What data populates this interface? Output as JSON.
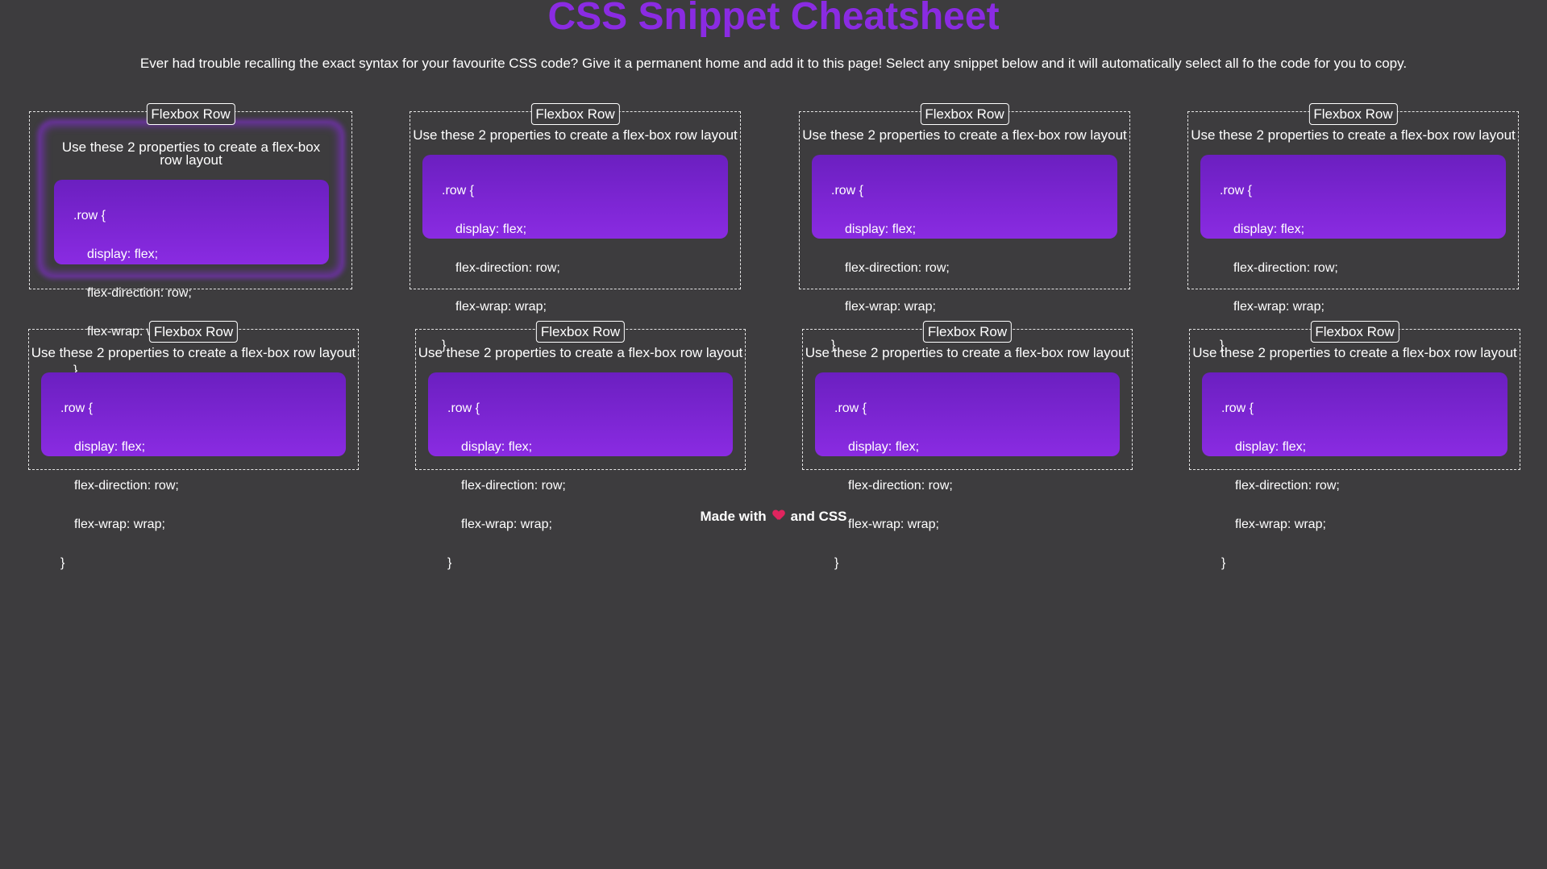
{
  "page": {
    "title": "CSS Snippet Cheatsheet",
    "intro": "Ever had trouble recalling the exact syntax for your favourite CSS code? Give it a permanent home and add it to this page! Select any snippet below and it will automatically select all fo the code for you to copy."
  },
  "snippets": [
    {
      "legend": "Flexbox Row",
      "description": "Use these 2 properties to create a flex-box row layout",
      "code": [
        ".row {",
        "display: flex;",
        "flex-direction: row;",
        "flex-wrap: wrap;",
        "}"
      ]
    },
    {
      "legend": "Flexbox Row",
      "description": "Use these 2 properties to create a flex-box row layout",
      "code": [
        ".row {",
        "display: flex;",
        "flex-direction: row;",
        "flex-wrap: wrap;",
        "}"
      ]
    },
    {
      "legend": "Flexbox Row",
      "description": "Use these 2 properties to create a flex-box row layout",
      "code": [
        ".row {",
        "display: flex;",
        "flex-direction: row;",
        "flex-wrap: wrap;",
        "}"
      ]
    },
    {
      "legend": "Flexbox Row",
      "description": "Use these 2 properties to create a flex-box row layout",
      "code": [
        ".row {",
        "display: flex;",
        "flex-direction: row;",
        "flex-wrap: wrap;",
        "}"
      ]
    },
    {
      "legend": "Flexbox Row",
      "description": "Use these 2 properties to create a flex-box row layout",
      "code": [
        ".row {",
        "display: flex;",
        "flex-direction: row;",
        "flex-wrap: wrap;",
        "}"
      ]
    },
    {
      "legend": "Flexbox Row",
      "description": "Use these 2 properties to create a flex-box row layout",
      "code": [
        ".row {",
        "display: flex;",
        "flex-direction: row;",
        "flex-wrap: wrap;",
        "}"
      ]
    },
    {
      "legend": "Flexbox Row",
      "description": "Use these 2 properties to create a flex-box row layout",
      "code": [
        ".row {",
        "display: flex;",
        "flex-direction: row;",
        "flex-wrap: wrap;",
        "}"
      ]
    },
    {
      "legend": "Flexbox Row",
      "description": "Use these 2 properties to create a flex-box row layout",
      "code": [
        ".row {",
        "display: flex;",
        "flex-direction: row;",
        "flex-wrap: wrap;",
        "}"
      ]
    }
  ],
  "footer": {
    "prefix": "Made with",
    "icon": "heart-icon",
    "suffix": "and CSS"
  },
  "colors": {
    "background": "#3d3c3e",
    "accent": "#8a2be2",
    "heart": "#e0245e"
  }
}
